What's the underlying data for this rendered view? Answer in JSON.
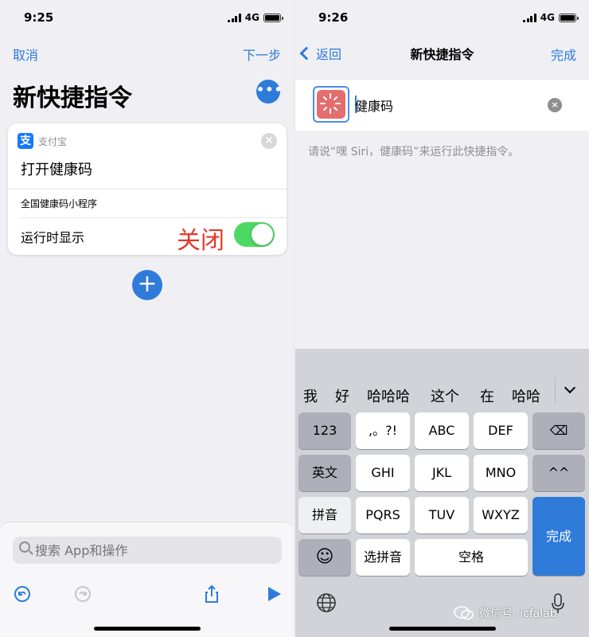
{
  "left": {
    "status": {
      "time": "9:25",
      "network": "4G"
    },
    "nav": {
      "cancel": "取消",
      "next": "下一步"
    },
    "title": "新快捷指令",
    "more_label": "•••",
    "card": {
      "app_name": "支付宝",
      "app_icon_glyph": "支",
      "action": "打开健康码",
      "subitem": "全国健康码小程序",
      "show_label": "运行时显示",
      "annotation": "关闭",
      "toggle_on": true
    },
    "add_label": "+",
    "search": {
      "placeholder": "搜索 App和操作"
    },
    "toolbar": [
      "undo-icon",
      "redo-icon",
      "share-icon",
      "play-icon"
    ]
  },
  "right": {
    "status": {
      "time": "9:26",
      "network": "4G"
    },
    "nav": {
      "back": "返回",
      "title": "新快捷指令",
      "done": "完成"
    },
    "shortcut_name": "健康码",
    "siri_hint": "请说“嘿 Siri，健康码”来运行此快捷指令。",
    "candidates": [
      "我",
      "好",
      "哈哈哈",
      "这个",
      "在",
      "哈哈"
    ],
    "keys": {
      "row1": [
        "123",
        ",。?!",
        "ABC",
        "DEF",
        "⌫"
      ],
      "row2": [
        "英文",
        "GHI",
        "JKL",
        "MNO",
        "^^"
      ],
      "row3": [
        "拼音",
        "PQRS",
        "TUV",
        "WXYZ"
      ],
      "row4": [
        "☺",
        "选拼音",
        "空格"
      ],
      "done": "完成"
    }
  },
  "watermark": "微信号: icfalab",
  "colors": {
    "accent": "#2f7bd9",
    "toggle_green": "#4cd964",
    "annotation_red": "#e23a2c",
    "shortcut_icon": "#e46d6d"
  }
}
